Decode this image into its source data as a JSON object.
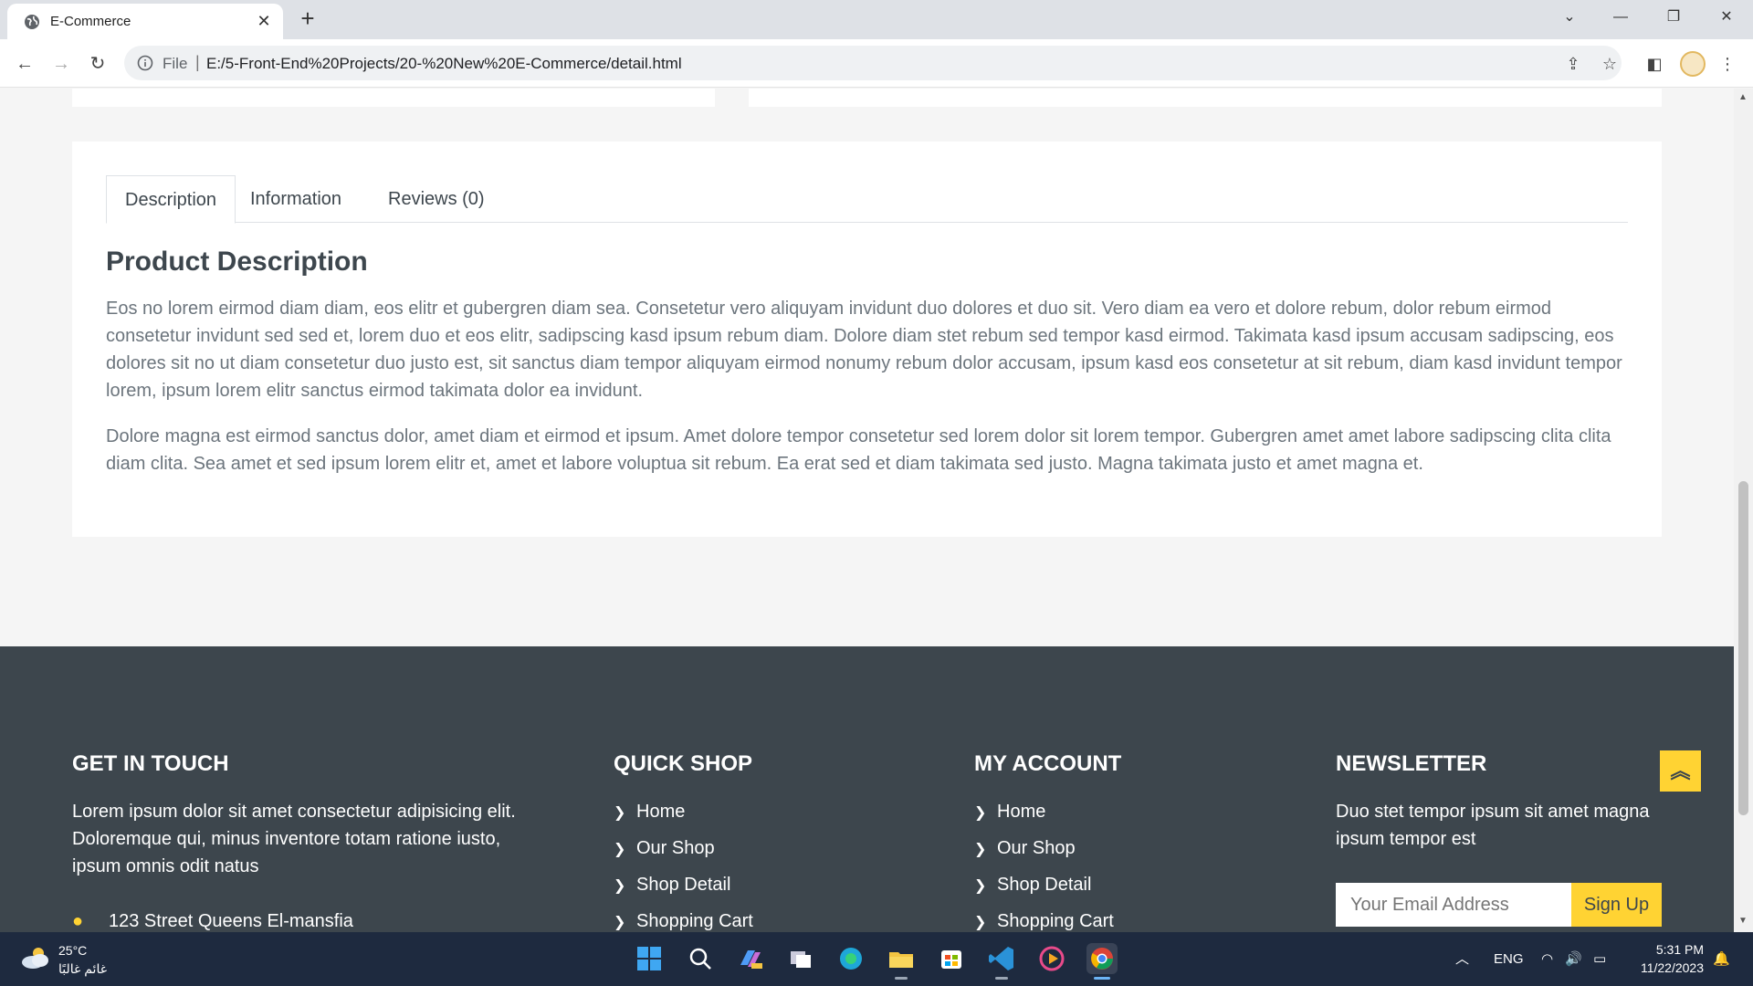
{
  "browser": {
    "tab_title": "E-Commerce",
    "omnibox_file_label": "File",
    "omnibox_separator": "|",
    "url": "E:/5-Front-End%20Projects/20-%20New%20E-Commerce/detail.html"
  },
  "product_tabs": [
    {
      "label": "Description"
    },
    {
      "label": "Information"
    },
    {
      "label": "Reviews (0)"
    }
  ],
  "description": {
    "title": "Product Description",
    "paragraph_1": "Eos no lorem eirmod diam diam, eos elitr et gubergren diam sea. Consetetur vero aliquyam invidunt duo dolores et duo sit. Vero diam ea vero et dolore rebum, dolor rebum eirmod consetetur invidunt sed sed et, lorem duo et eos elitr, sadipscing kasd ipsum rebum diam. Dolore diam stet rebum sed tempor kasd eirmod. Takimata kasd ipsum accusam sadipscing, eos dolores sit no ut diam consetetur duo justo est, sit sanctus diam tempor aliquyam eirmod nonumy rebum dolor accusam, ipsum kasd eos consetetur at sit rebum, diam kasd invidunt tempor lorem, ipsum lorem elitr sanctus eirmod takimata dolor ea invidunt.",
    "paragraph_2": "Dolore magna est eirmod sanctus dolor, amet diam et eirmod et ipsum. Amet dolore tempor consetetur sed lorem dolor sit lorem tempor. Gubergren amet amet labore sadipscing clita clita diam clita. Sea amet et sed ipsum lorem elitr et, amet et labore voluptua sit rebum. Ea erat sed et diam takimata sed justo. Magna takimata justo et amet magna et."
  },
  "footer": {
    "get_in_touch": {
      "heading": "GET IN TOUCH",
      "text": "Lorem ipsum dolor sit amet consectetur adipisicing elit. Doloremque qui, minus inventore totam ratione iusto, ipsum omnis odit natus",
      "address_partial": "123 Street Queens El-mansfia"
    },
    "quick_shop": {
      "heading": "QUICK SHOP",
      "links": [
        "Home",
        "Our Shop",
        "Shop Detail",
        "Shopping Cart"
      ]
    },
    "my_account": {
      "heading": "MY ACCOUNT",
      "links": [
        "Home",
        "Our Shop",
        "Shop Detail",
        "Shopping Cart"
      ]
    },
    "newsletter": {
      "heading": "NEWSLETTER",
      "text": "Duo stet tempor ipsum sit amet magna ipsum tempor est",
      "email_placeholder": "Your Email Address",
      "button_label": "Sign Up"
    }
  },
  "taskbar": {
    "weather_temp": "25°C",
    "weather_desc": "غائم غالبًا",
    "language": "ENG",
    "time": "5:31 PM",
    "date": "11/22/2023"
  },
  "colors": {
    "accent": "#ffd333",
    "footer_bg": "#3d464d",
    "page_bg": "#f5f5f5",
    "taskbar_bg": "#1e2a3f"
  },
  "icons": {
    "tab_favicon": "globe-icon",
    "back_to_top": "double-chevron-up-icon",
    "footer_link_bullet": "chevron-right-icon",
    "address": "map-marker-icon"
  }
}
